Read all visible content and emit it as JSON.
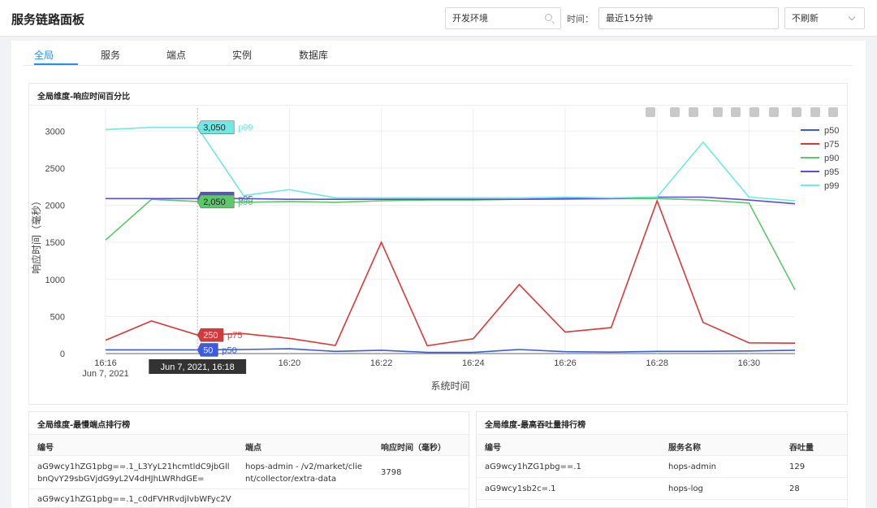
{
  "header": {
    "title": "服务链路面板",
    "env": "开发环境",
    "time_label": "时间：",
    "time_value": "最近15分钟",
    "refresh": "不刷新"
  },
  "tabs": [
    "全局",
    "服务",
    "端点",
    "实例",
    "数据库"
  ],
  "chart_panel": {
    "title": "全局维度-响应时间百分比",
    "hover_label": "Jun 7, 2021, 16:18"
  },
  "colors": {
    "p50": "#3a5ae8",
    "p75": "#d9383a",
    "p90": "#5cc86a",
    "p95": "#5b4fd1",
    "p99": "#6fe9e3",
    "accent": "#1890ff"
  },
  "chart_data": {
    "type": "line",
    "title": "",
    "xlabel": "系统时间",
    "ylabel": "响应时间（毫秒）",
    "ylim": [
      0,
      3200
    ],
    "yticks": [
      0,
      500,
      1000,
      1500,
      2000,
      2500,
      3000
    ],
    "x": [
      "16:16",
      "16:17",
      "16:18",
      "16:19",
      "16:20",
      "16:21",
      "16:22",
      "16:23",
      "16:24",
      "16:25",
      "16:26",
      "16:27",
      "16:28",
      "16:29",
      "16:30",
      "16:31"
    ],
    "xtick_labels": [
      {
        "x": "16:16",
        "lines": [
          "16:16",
          "Jun 7, 2021"
        ]
      },
      {
        "x": "16:18",
        "lines": [
          "16:18"
        ]
      },
      {
        "x": "16:20",
        "lines": [
          "16:20"
        ]
      },
      {
        "x": "16:22",
        "lines": [
          "16:22"
        ]
      },
      {
        "x": "16:24",
        "lines": [
          "16:24"
        ]
      },
      {
        "x": "16:26",
        "lines": [
          "16:26"
        ]
      },
      {
        "x": "16:28",
        "lines": [
          "16:28"
        ]
      },
      {
        "x": "16:30",
        "lines": [
          "16:30"
        ]
      }
    ],
    "legend_position": "right",
    "grid": true,
    "series": [
      {
        "name": "p50",
        "values": [
          50,
          50,
          50,
          55,
          65,
          30,
          45,
          15,
          15,
          55,
          25,
          20,
          30,
          30,
          35,
          45
        ]
      },
      {
        "name": "p75",
        "values": [
          180,
          440,
          250,
          270,
          205,
          110,
          1500,
          105,
          200,
          930,
          290,
          350,
          2060,
          420,
          145,
          140
        ]
      },
      {
        "name": "p90",
        "values": [
          1530,
          2080,
          2050,
          2040,
          2050,
          2040,
          2060,
          2070,
          2070,
          2080,
          2080,
          2090,
          2090,
          2070,
          2030,
          860
        ]
      },
      {
        "name": "p95",
        "values": [
          2090,
          2090,
          2090,
          2090,
          2080,
          2080,
          2080,
          2080,
          2080,
          2080,
          2090,
          2090,
          2110,
          2110,
          2070,
          2020
        ]
      },
      {
        "name": "p99",
        "values": [
          3020,
          3050,
          3050,
          2130,
          2210,
          2100,
          2100,
          2100,
          2100,
          2100,
          2110,
          2100,
          2110,
          2850,
          2110,
          2060
        ]
      }
    ],
    "tooltips": [
      {
        "series": "p99",
        "x": "16:18",
        "value": 3050
      },
      {
        "series": "p95",
        "x": "16:18",
        "value": 2090
      },
      {
        "series": "p90",
        "x": "16:18",
        "value": 2050
      },
      {
        "series": "p75",
        "x": "16:18",
        "value": 250
      },
      {
        "series": "p50",
        "x": "16:18",
        "value": 50
      }
    ]
  },
  "slow_endpoints": {
    "title": "全局维度-最慢端点排行榜",
    "columns": [
      "编号",
      "端点",
      "响应时间（毫秒）"
    ],
    "rows": [
      {
        "id": "aG9wcy1hZG1pbg==.1_L3YyL21hcmtldC9jbGllbnQvY29sbGVjdG9yL2V4dHJhLWRhdGE=",
        "endpoint": "hops-admin - /v2/market/client/collector/extra-data",
        "rt": "3798"
      },
      {
        "id": "aG9wcy1hZG1pbg==.1_c0dFVHRvdjlvbWFyc2V",
        "endpoint": "",
        "rt": ""
      }
    ]
  },
  "top_throughput": {
    "title": "全局维度-最高吞吐量排行榜",
    "columns": [
      "编号",
      "服务名称",
      "吞吐量"
    ],
    "rows": [
      {
        "id": "aG9wcy1hZG1pbg==.1",
        "name": "hops-admin",
        "tp": "129"
      },
      {
        "id": "aG9wcy1sb2c=.1",
        "name": "hops-log",
        "tp": "28"
      }
    ]
  }
}
